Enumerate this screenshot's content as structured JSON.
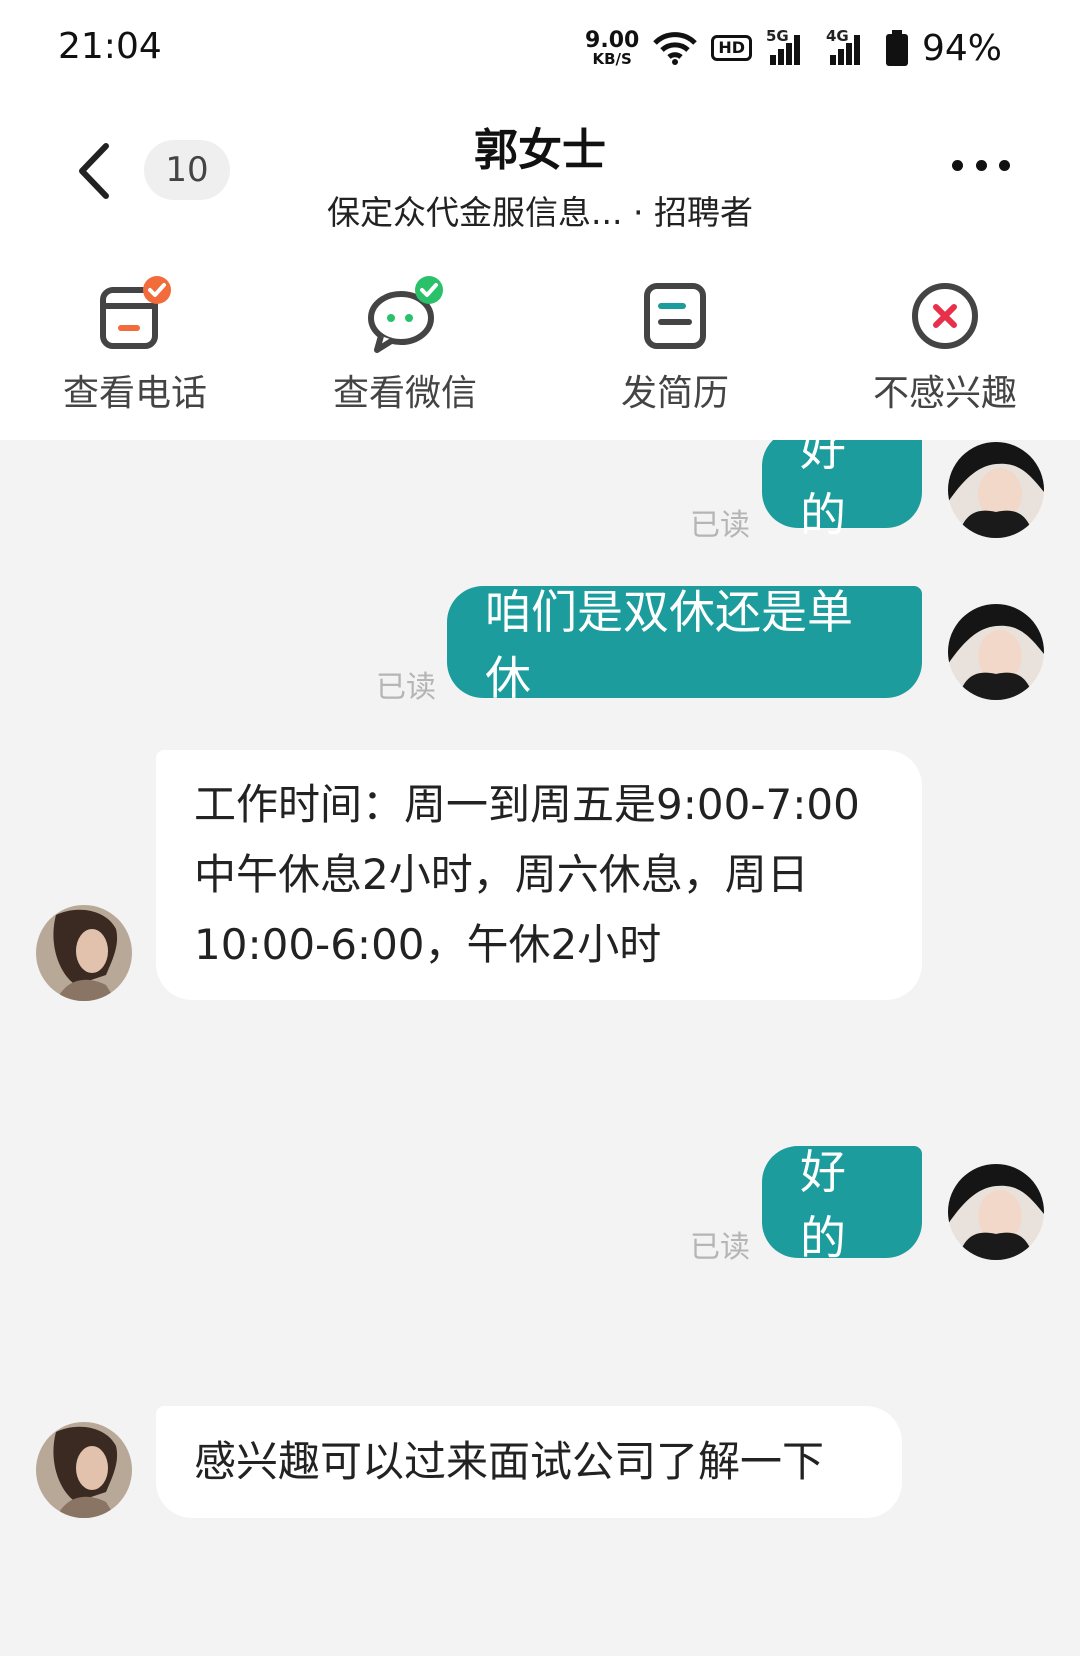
{
  "status_bar": {
    "time": "21:04",
    "net_speed_value": "9.00",
    "net_speed_unit": "KB/S",
    "hd_label": "HD",
    "signal_1": "5G",
    "signal_2": "4G",
    "battery": "94%"
  },
  "header": {
    "unread_count": "10",
    "title": "郭女士",
    "subtitle": "保定众代金服信息... · 招聘者"
  },
  "actions": [
    {
      "label": "查看电话",
      "icon": "phone-card-icon"
    },
    {
      "label": "查看微信",
      "icon": "wechat-icon"
    },
    {
      "label": "发简历",
      "icon": "resume-icon"
    },
    {
      "label": "不感兴趣",
      "icon": "not-interested-icon"
    }
  ],
  "messages": [
    {
      "from": "me",
      "text": "好的",
      "status": "已读"
    },
    {
      "from": "me",
      "text": "咱们是双休还是单休",
      "status": "已读"
    },
    {
      "from": "them",
      "lines": [
        "工作时间：周一到周五是9:00-7:00",
        "中午休息2小时，周六休息，周日",
        "10:00-6:00，午休2小时"
      ]
    },
    {
      "from": "me",
      "text": "好的",
      "status": "已读"
    },
    {
      "from": "them",
      "text": "感兴趣可以过来面试公司了解一下"
    }
  ],
  "colors": {
    "accent": "#1c9c9c",
    "badge_orange": "#f26b3a",
    "badge_green": "#2bc06a",
    "reject_red": "#e8304a"
  }
}
